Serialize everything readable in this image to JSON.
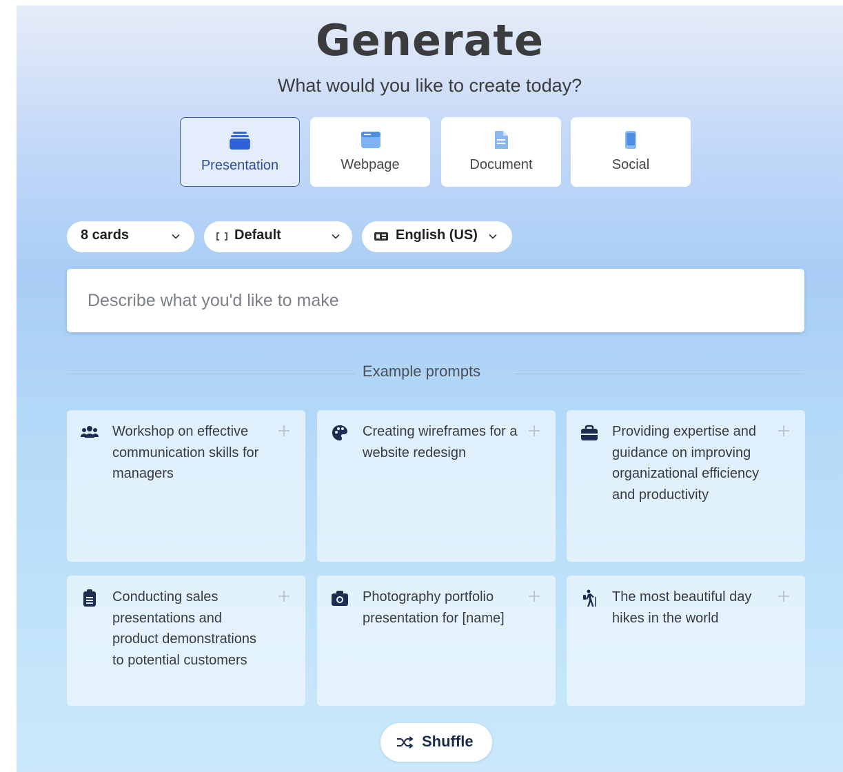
{
  "header": {
    "title": "Generate",
    "subtitle": "What would you like to create today?"
  },
  "types": [
    {
      "label": "Presentation",
      "icon": "presentation-icon",
      "active": true
    },
    {
      "label": "Webpage",
      "icon": "webpage-icon",
      "active": false
    },
    {
      "label": "Document",
      "icon": "document-icon",
      "active": false
    },
    {
      "label": "Social",
      "icon": "social-icon",
      "active": false
    }
  ],
  "options": {
    "cards": "8 cards",
    "format": "Default",
    "language": "English (US)"
  },
  "prompt": {
    "placeholder": "Describe what you'd like to make",
    "value": ""
  },
  "examples": {
    "heading": "Example prompts",
    "cards": [
      {
        "icon": "users-icon",
        "text": "Workshop on effective communication skills for managers"
      },
      {
        "icon": "palette-icon",
        "text": "Creating wireframes for a website redesign"
      },
      {
        "icon": "briefcase-icon",
        "text": "Providing expertise and guidance on improving organizational efficiency and productivity"
      },
      {
        "icon": "clipboard-icon",
        "text": "Conducting sales presentations and product demonstrations to potential customers"
      },
      {
        "icon": "camera-icon",
        "text": "Photography portfolio presentation for [name]"
      },
      {
        "icon": "hiking-icon",
        "text": "The most beautiful day hikes in the world"
      }
    ]
  },
  "shuffle": {
    "label": "Shuffle",
    "icon": "shuffle-icon"
  },
  "colors": {
    "accent": "#2e4f93",
    "icon_dark": "#1d2d52",
    "icon_blue": "#2f62d8",
    "text": "#3c3c3e"
  }
}
